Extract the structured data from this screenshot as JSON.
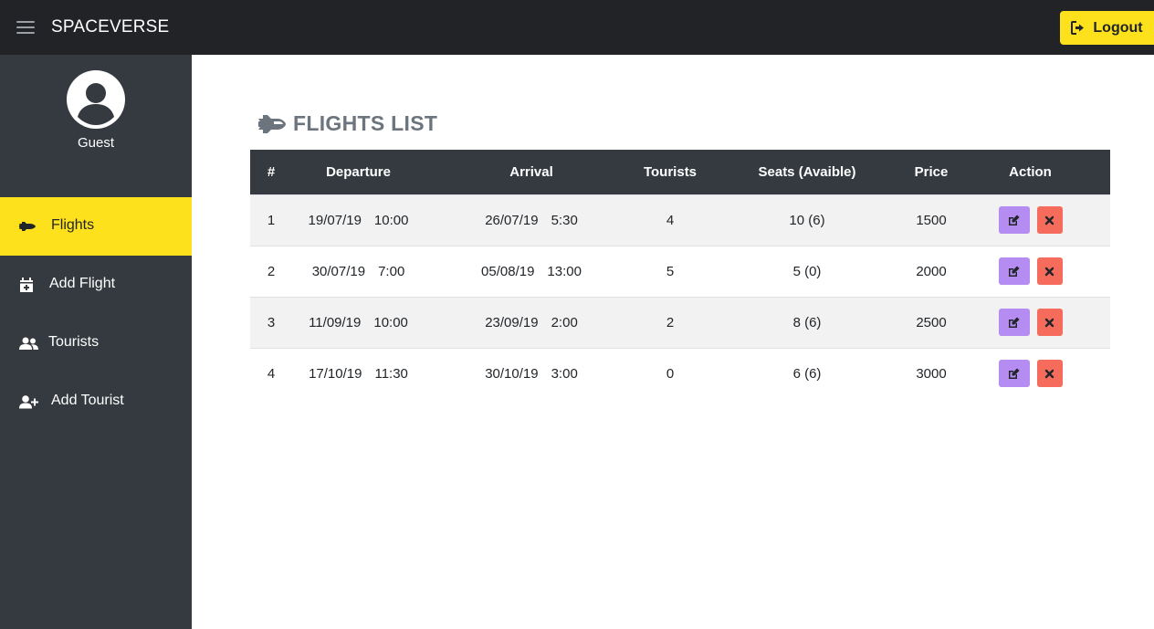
{
  "app": {
    "brand": "SPACEVERSE",
    "logout_label": "Logout"
  },
  "colors": {
    "accent": "#fde11c",
    "sidebar_bg": "#343a40",
    "topbar_bg": "#212327",
    "edit_button": "#b58cf2",
    "delete_button": "#f56b5c"
  },
  "user": {
    "name": "Guest"
  },
  "sidebar": {
    "items": [
      {
        "label": "Flights",
        "icon": "space-shuttle-icon",
        "active": true
      },
      {
        "label": "Add Flight",
        "icon": "calendar-plus-icon",
        "active": false
      },
      {
        "label": "Tourists",
        "icon": "users-icon",
        "active": false
      },
      {
        "label": "Add Tourist",
        "icon": "user-plus-icon",
        "active": false
      }
    ]
  },
  "main": {
    "title": "FLIGHTS LIST",
    "title_icon": "space-shuttle-icon"
  },
  "table": {
    "headers": [
      "#",
      "Departure",
      "Arrival",
      "Tourists",
      "Seats (Avaible)",
      "Price",
      "Action"
    ],
    "rows": [
      {
        "num": "1",
        "dep_date": "19/07/19",
        "dep_time": "10:00",
        "arr_date": "26/07/19",
        "arr_time": "5:30",
        "tourists": "4",
        "seats": "10 (6)",
        "price": "1500"
      },
      {
        "num": "2",
        "dep_date": "30/07/19",
        "dep_time": "7:00",
        "arr_date": "05/08/19",
        "arr_time": "13:00",
        "tourists": "5",
        "seats": "5 (0)",
        "price": "2000"
      },
      {
        "num": "3",
        "dep_date": "11/09/19",
        "dep_time": "10:00",
        "arr_date": "23/09/19",
        "arr_time": "2:00",
        "tourists": "2",
        "seats": "8 (6)",
        "price": "2500"
      },
      {
        "num": "4",
        "dep_date": "17/10/19",
        "dep_time": "11:30",
        "arr_date": "30/10/19",
        "arr_time": "3:00",
        "tourists": "0",
        "seats": "6 (6)",
        "price": "3000"
      }
    ],
    "action_icons": {
      "edit": "edit-icon",
      "delete": "close-icon"
    }
  }
}
